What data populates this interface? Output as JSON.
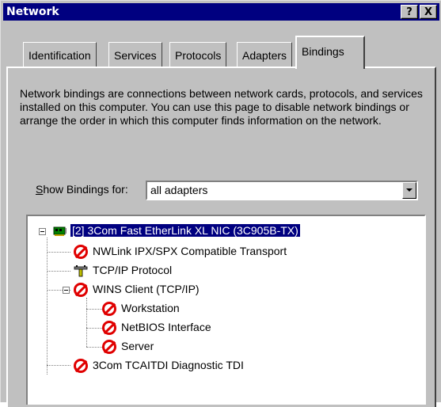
{
  "window": {
    "title": "Network",
    "help_button": "?",
    "close_button": "X"
  },
  "tabs": [
    {
      "label": "Identification",
      "active": false
    },
    {
      "label": "Services",
      "active": false
    },
    {
      "label": "Protocols",
      "active": false
    },
    {
      "label": "Adapters",
      "active": false
    },
    {
      "label": "Bindings",
      "active": true
    }
  ],
  "bindings": {
    "description": "Network bindings are connections between network cards, protocols, and services installed on this computer.  You can use this page to disable network bindings or arrange the order in which this computer finds information on the network.",
    "show_label_accel": "S",
    "show_label_rest": "how Bindings for:",
    "show_for_value": "all adapters",
    "tree": {
      "root": {
        "label": "[2] 3Com Fast EtherLink XL NIC (3C905B-TX)",
        "icon": "network-card-icon",
        "expanded": true,
        "selected": true
      },
      "children": [
        {
          "label": "NWLink IPX/SPX Compatible Transport",
          "icon": "disabled-icon"
        },
        {
          "label": "TCP/IP Protocol",
          "icon": "protocol-icon"
        },
        {
          "label": "WINS Client (TCP/IP)",
          "icon": "disabled-icon",
          "expanded": true,
          "children": [
            {
              "label": "Workstation",
              "icon": "disabled-icon"
            },
            {
              "label": "NetBIOS Interface",
              "icon": "disabled-icon"
            },
            {
              "label": "Server",
              "icon": "disabled-icon"
            }
          ]
        },
        {
          "label": "3Com TCAITDI Diagnostic TDI",
          "icon": "disabled-icon"
        }
      ]
    }
  }
}
